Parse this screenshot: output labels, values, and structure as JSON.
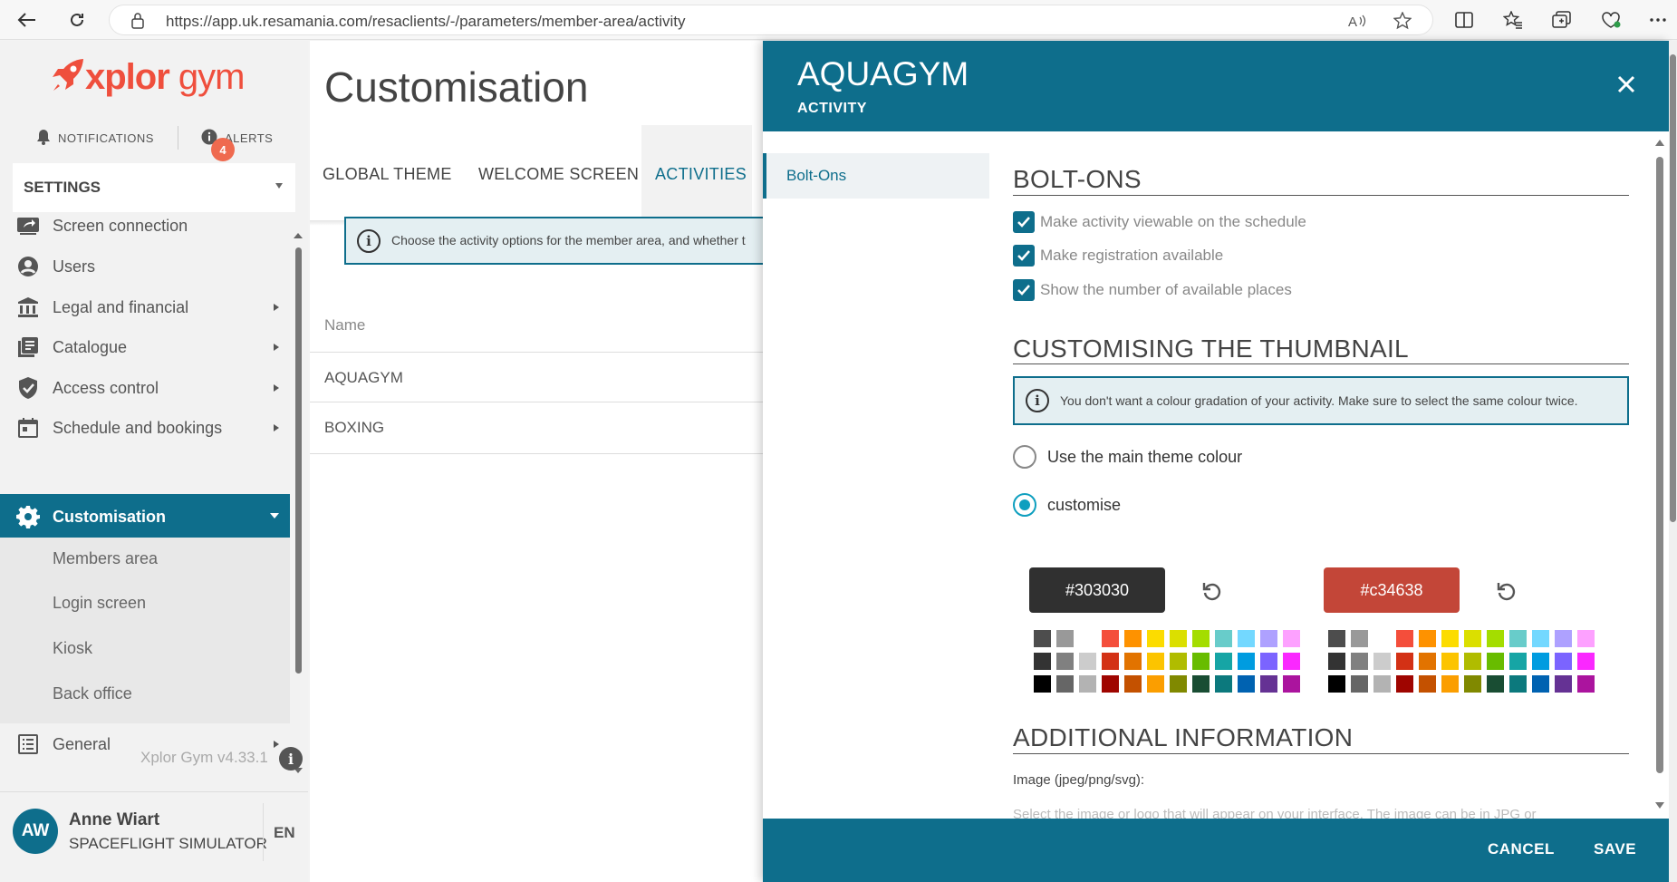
{
  "browser": {
    "url": "https://app.uk.resamania.com/resaclients/-/parameters/member-area/activity"
  },
  "sidebar": {
    "logo_main": "xplor",
    "logo_sub": "gym",
    "notifications_label": "NOTIFICATIONS",
    "alerts_label": "ALERTS",
    "alerts_count": "4",
    "settings_label": "SETTINGS",
    "items": [
      {
        "label": "Screen connection",
        "icon": "screen-share-icon"
      },
      {
        "label": "Users",
        "icon": "user-circle-icon"
      },
      {
        "label": "Legal and financial",
        "icon": "bank-icon"
      },
      {
        "label": "Catalogue",
        "icon": "catalogue-icon"
      },
      {
        "label": "Access control",
        "icon": "shield-check-icon"
      },
      {
        "label": "Schedule and bookings",
        "icon": "calendar-icon"
      },
      {
        "label": "Customisation",
        "icon": "gear-icon"
      },
      {
        "label": "General",
        "icon": "list-icon"
      }
    ],
    "sub_items": [
      "Members area",
      "Login screen",
      "Kiosk",
      "Back office"
    ],
    "version": "Xplor Gym v4.33.1",
    "user": {
      "initials": "AW",
      "name": "Anne Wiart",
      "org": "SPACEFLIGHT SIMULATOR",
      "lang": "EN"
    }
  },
  "main": {
    "title": "Customisation",
    "tabs": [
      "GLOBAL THEME",
      "WELCOME SCREEN",
      "ACTIVITIES"
    ],
    "active_tab": "ACTIVITIES",
    "info": "Choose the activity options for the member area, and whether t",
    "column_name": "Name",
    "rows": [
      "AQUAGYM",
      "BOXING"
    ]
  },
  "dialog": {
    "title": "AQUAGYM",
    "subtitle": "ACTIVITY",
    "left_nav": "Bolt-Ons",
    "bolt_ons": {
      "title": "BOLT-ONS",
      "options": [
        "Make activity viewable on the schedule",
        "Make registration available",
        "Show the number of available places"
      ]
    },
    "thumbnail": {
      "title": "CUSTOMISING THE THUMBNAIL",
      "info": "You don't want a colour gradation of your activity. Make sure to select the same colour twice.",
      "radio_main": "Use the main theme colour",
      "radio_custom": "customise",
      "color1": "#303030",
      "color2": "#c34638"
    },
    "additional": {
      "title": "ADDITIONAL INFORMATION",
      "image_label": "Image (jpeg/png/svg):",
      "image_desc": "Select the image or logo that will appear on your interface. The image can be in JPG or"
    },
    "cancel": "CANCEL",
    "save": "SAVE"
  },
  "palette": [
    "#4d4d4d",
    "#999999",
    "#ffffff",
    "#f44e3b",
    "#fe9200",
    "#fcdc00",
    "#dbdf00",
    "#a4dd00",
    "#68ccca",
    "#73d8ff",
    "#aea1ff",
    "#fda1ff",
    "#333333",
    "#808080",
    "#cccccc",
    "#d33115",
    "#e27300",
    "#fcc400",
    "#b0bc00",
    "#68bc00",
    "#16a5a5",
    "#009ce0",
    "#7b64ff",
    "#fa28ff",
    "#000000",
    "#666666",
    "#b3b3b3",
    "#9f0500",
    "#c45100",
    "#fb9e00",
    "#808900",
    "#194d33",
    "#0c797d",
    "#0062b1",
    "#653294",
    "#ab149e"
  ]
}
